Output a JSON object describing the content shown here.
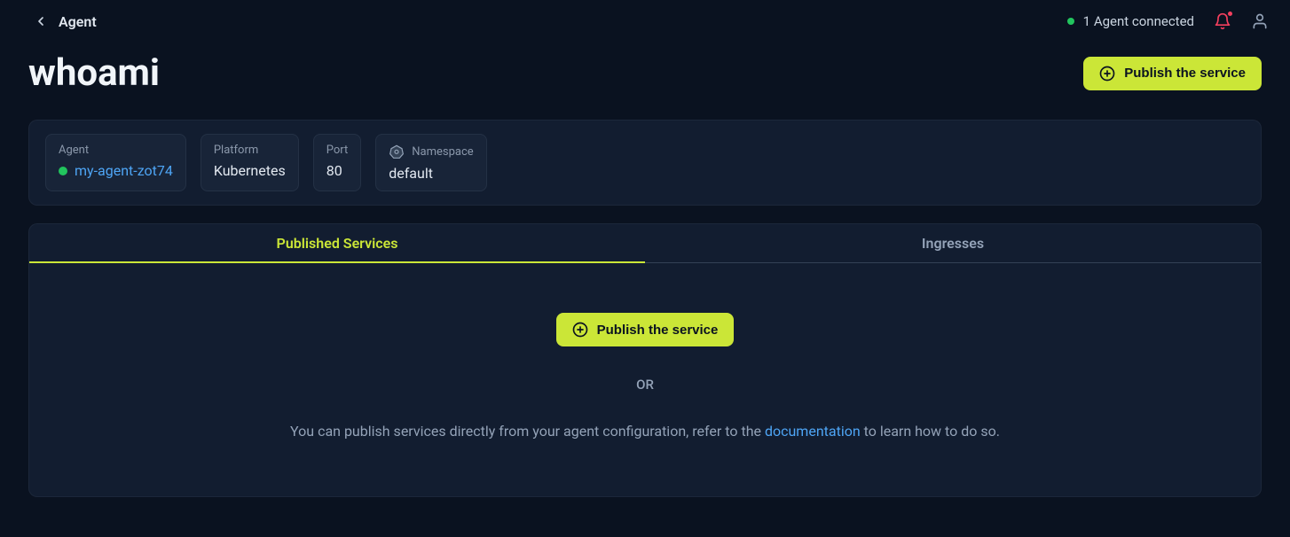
{
  "topbar": {
    "breadcrumb": "Agent",
    "status_text": "1 Agent connected"
  },
  "header": {
    "title": "whoami",
    "publish_label": "Publish the service"
  },
  "info": {
    "agent": {
      "label": "Agent",
      "value": "my-agent-zot74"
    },
    "platform": {
      "label": "Platform",
      "value": "Kubernetes"
    },
    "port": {
      "label": "Port",
      "value": "80"
    },
    "namespace": {
      "label": "Namespace",
      "value": "default"
    }
  },
  "tabs": {
    "published": "Published Services",
    "ingresses": "Ingresses"
  },
  "empty": {
    "publish_label": "Publish the service",
    "or_label": "OR",
    "hint_before": "You can publish services directly from your agent configuration, refer to the ",
    "hint_link": "documentation",
    "hint_after": " to learn how to do so."
  }
}
